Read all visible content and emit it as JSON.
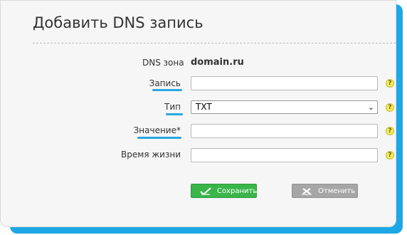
{
  "page": {
    "title": "Добавить DNS запись"
  },
  "form": {
    "zone_label": "DNS зона",
    "zone_value": "domain.ru",
    "record_label": "Запись",
    "record_value": "",
    "type_label": "Тип",
    "type_value": "TXT",
    "value_label": "Значение*",
    "value_value": "",
    "ttl_label": "Время жизни",
    "ttl_value": ""
  },
  "help": {
    "glyph": "?"
  },
  "buttons": {
    "save_label": "Сохранить",
    "cancel_label": "Отменить"
  },
  "colors": {
    "accent": "#1ea7e6",
    "save": "#3ab54a",
    "cancel": "#a6a6a6"
  }
}
